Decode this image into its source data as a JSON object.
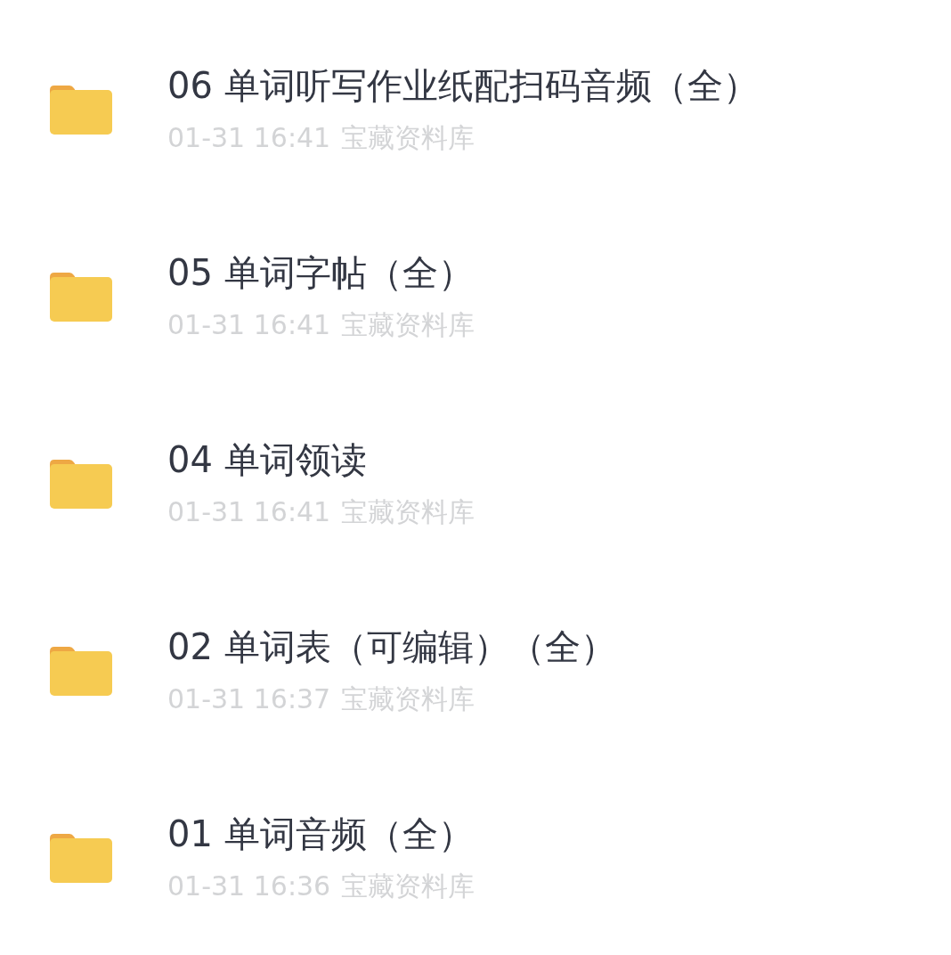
{
  "files": [
    {
      "name": "06 单词听写作业纸配扫码音频（全）",
      "time": "01-31 16:41",
      "source": "宝藏资料库"
    },
    {
      "name": "05 单词字帖（全）",
      "time": "01-31 16:41",
      "source": "宝藏资料库"
    },
    {
      "name": "04 单词领读",
      "time": "01-31 16:41",
      "source": "宝藏资料库"
    },
    {
      "name": "02 单词表（可编辑）（全）",
      "time": "01-31 16:37",
      "source": "宝藏资料库"
    },
    {
      "name": "01 单词音频（全）",
      "time": "01-31 16:36",
      "source": "宝藏资料库"
    }
  ]
}
